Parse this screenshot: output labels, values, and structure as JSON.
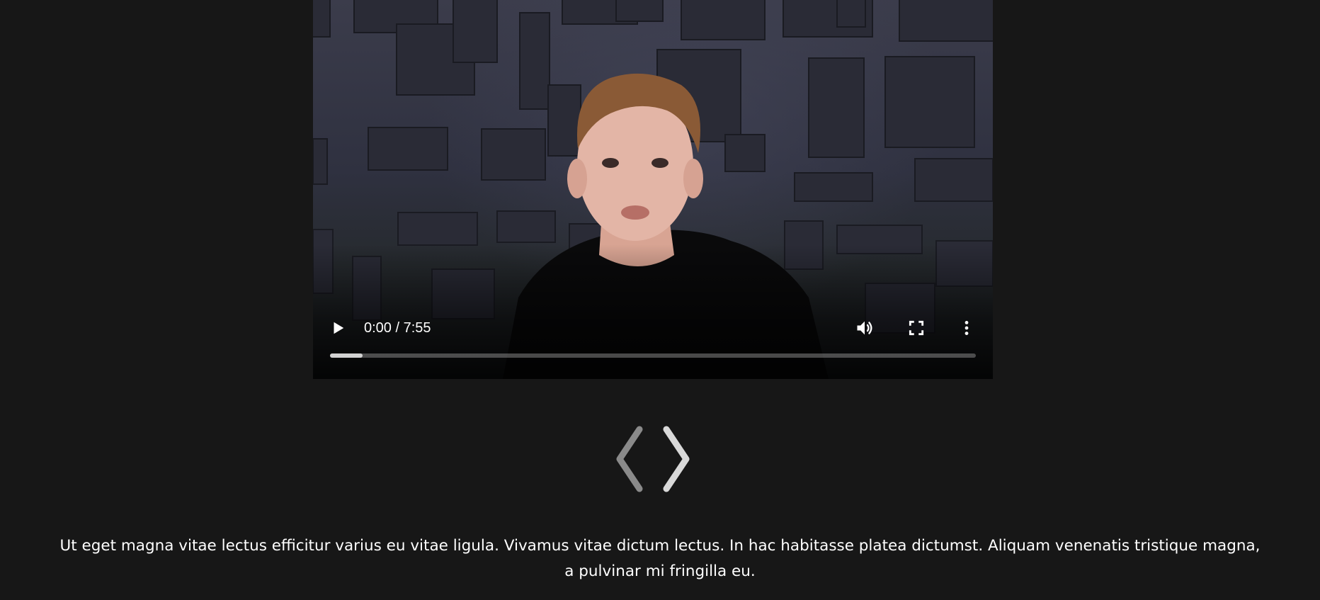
{
  "video": {
    "current_time": "0:00",
    "duration": "7:55",
    "time_display": "0:00 / 7:55",
    "buffered_fraction": 0.05,
    "played_fraction": 0.0,
    "icons": {
      "play": "play-icon",
      "volume": "volume-icon",
      "fullscreen": "fullscreen-icon",
      "more": "more-vertical-icon"
    }
  },
  "carousel": {
    "prev_icon": "chevron-left-icon",
    "next_icon": "chevron-right-icon"
  },
  "caption": {
    "text": "Ut eget magna vitae lectus efficitur varius eu vitae ligula. Vivamus vitae dictum lectus. In hac habitasse platea dictumst. Aliquam venenatis tristique magna, a pulvinar mi fringilla eu."
  },
  "colors": {
    "page_background": "#171717",
    "text": "#ffffff",
    "prev_arrow": "#8a8a8a",
    "next_arrow": "#d9d9d9"
  }
}
